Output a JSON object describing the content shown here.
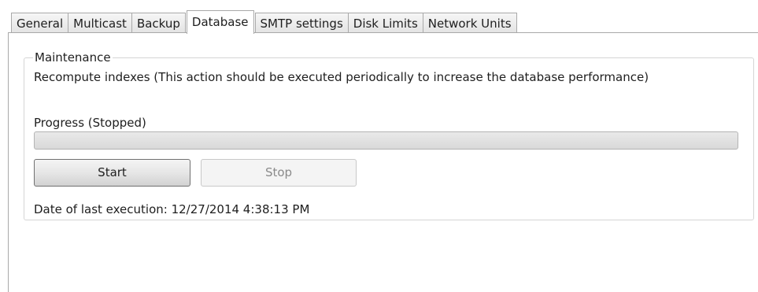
{
  "tabs": [
    {
      "label": "General"
    },
    {
      "label": "Multicast"
    },
    {
      "label": "Backup"
    },
    {
      "label": "Database"
    },
    {
      "label": "SMTP settings"
    },
    {
      "label": "Disk Limits"
    },
    {
      "label": "Network Units"
    }
  ],
  "active_tab": "Database",
  "maintenance": {
    "group_title": "Maintenance",
    "description": "Recompute indexes (This action should be executed periodically to increase the database performance)",
    "progress_label": "Progress (Stopped)",
    "progress_value": 0,
    "start_label": "Start",
    "stop_label": "Stop",
    "stop_enabled": false,
    "last_execution_label": "Date of last execution: 12/27/2014 4:38:13 PM"
  }
}
